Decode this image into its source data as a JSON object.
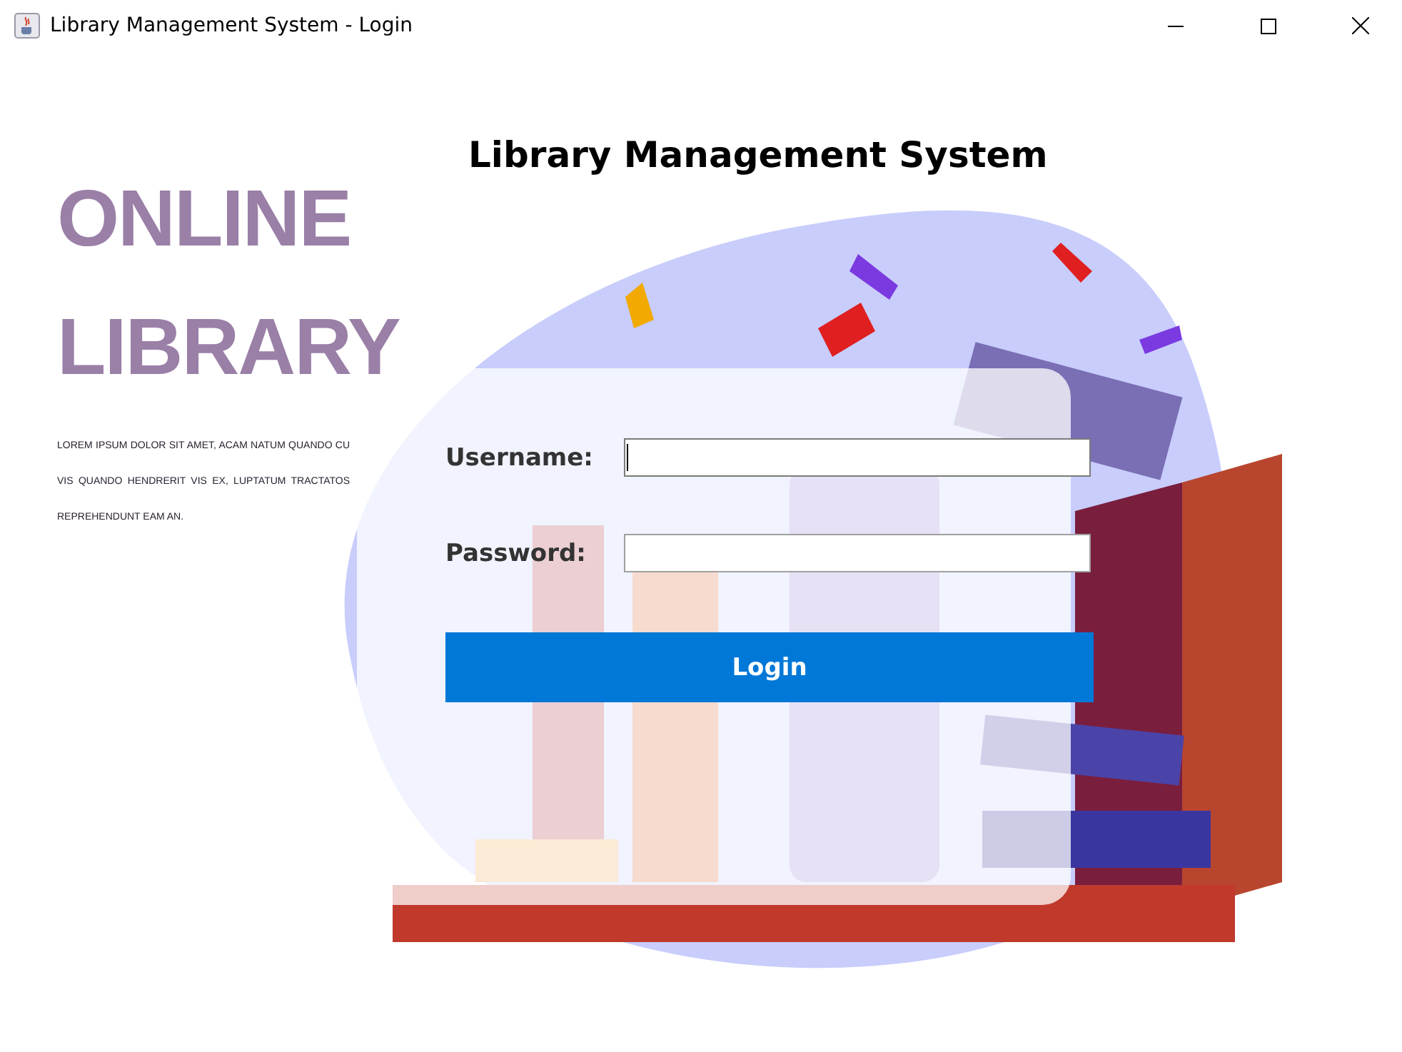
{
  "window": {
    "title": "Library Management System - Login"
  },
  "brand": {
    "lines": [
      "ONLINE",
      "LIBRARY"
    ],
    "text": "LOREM IPSUM DOLOR SIT AMET, ACAM NATUM QUANDO CU VIS QUANDO HENDRERIT VIS EX, LUPTATUM TRACTATOS REPREHENDUNT EAM AN."
  },
  "heading": "Library Management System",
  "fields": [
    {
      "label": "Username:",
      "focused": true
    },
    {
      "label": "Password:",
      "focused": false
    }
  ],
  "login_button": "Login"
}
